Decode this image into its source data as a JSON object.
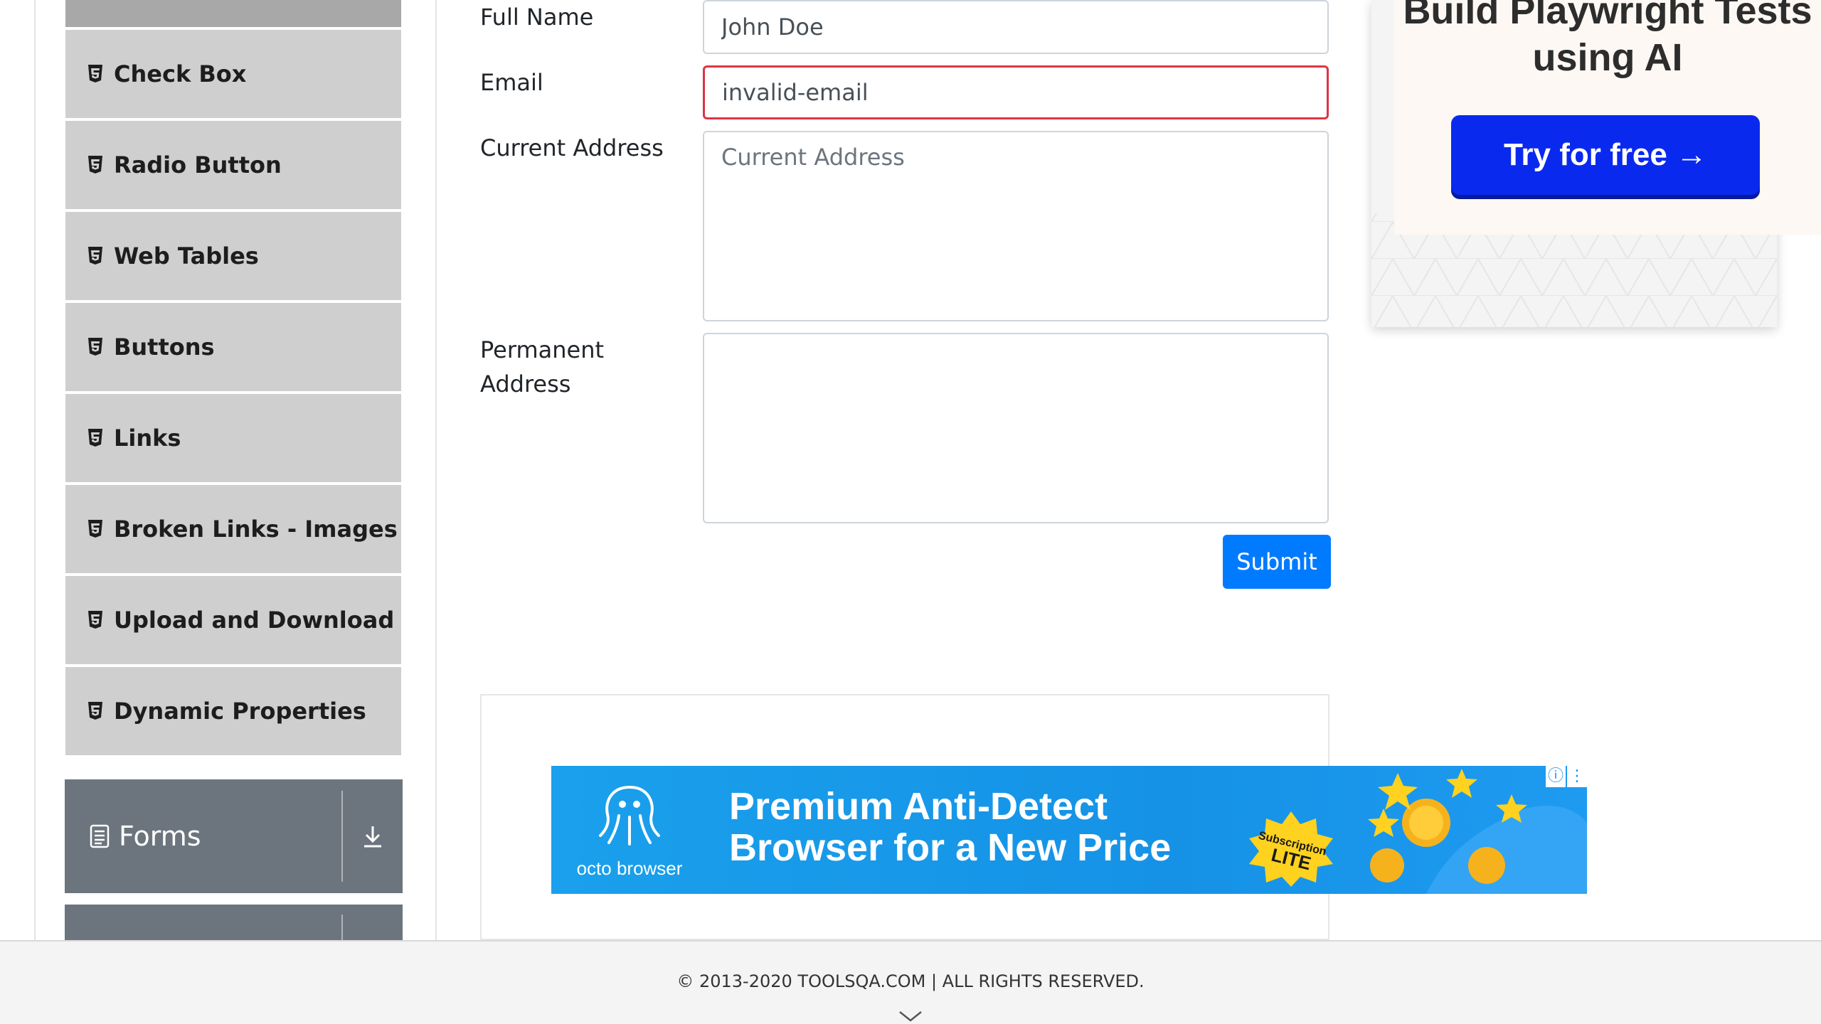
{
  "sidebar": {
    "items": [
      {
        "label": "Check Box"
      },
      {
        "label": "Radio Button"
      },
      {
        "label": "Web Tables"
      },
      {
        "label": "Buttons"
      },
      {
        "label": "Links"
      },
      {
        "label": "Broken Links - Images"
      },
      {
        "label": "Upload and Download"
      },
      {
        "label": "Dynamic Properties"
      }
    ],
    "groups": [
      {
        "label": "Forms",
        "icon": "form-icon"
      },
      {
        "label": "",
        "icon": ""
      }
    ]
  },
  "form": {
    "full_name_label": "Full Name",
    "full_name_value": "John Doe",
    "email_label": "Email",
    "email_value": "invalid-email",
    "current_address_label": "Current Address",
    "current_address_placeholder": "Current Address",
    "permanent_address_label": "Permanent Address",
    "permanent_address_placeholder": "",
    "submit_label": "Submit",
    "error_color": "#dc3545"
  },
  "ad_top": {
    "title": "Build Playwright Tests using AI",
    "button_label": "Try for free →"
  },
  "ad_banner": {
    "brand": "octo browser",
    "headline_line1": "Premium Anti-Detect",
    "headline_line2": "Browser for a New Price",
    "badge_line1": "Subscription",
    "badge_line2": "LITE"
  },
  "footer": {
    "text": "© 2013-2020 TOOLSQA.COM | ALL RIGHTS RESERVED."
  }
}
